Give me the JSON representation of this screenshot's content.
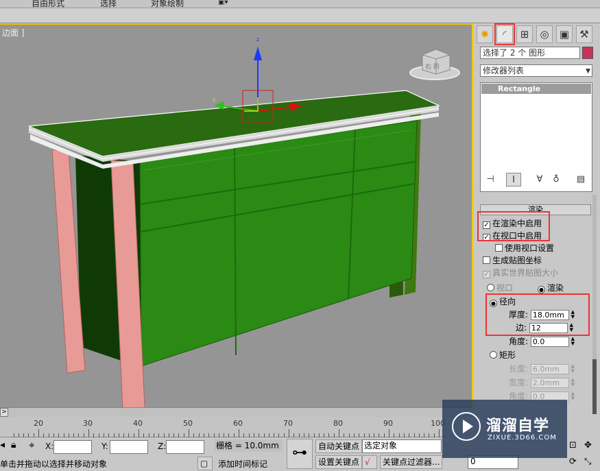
{
  "menu": {
    "items": [
      "自由形式",
      "选择",
      "对象绘制"
    ]
  },
  "viewport": {
    "label": "边面 ]",
    "viewcube_label": "右 前"
  },
  "command_panel": {
    "tabs": [
      "create-icon",
      "modify-icon",
      "hierarchy-icon",
      "motion-icon",
      "display-icon",
      "utilities-icon"
    ],
    "selection_text": "选择了 2 个 图形",
    "object_color": "#c8325a",
    "modifier_list": "修改器列表",
    "stack_item": "Rectangle"
  },
  "rendering": {
    "title": "渲染",
    "enable_in_renderer": "在渲染中启用",
    "enable_in_viewport": "在视口中启用",
    "use_viewport_settings": "使用视口设置",
    "gen_mapping_coords": "生成贴图坐标",
    "real_world_map_size": "真实世界贴图大小",
    "viewport_option": "视口",
    "render_option": "渲染",
    "radial": "径向",
    "thickness_label": "厚度:",
    "thickness_value": "18.0mm",
    "sides_label": "边:",
    "sides_value": "12",
    "angle_label": "角度:",
    "angle_value": "0.0",
    "rectangular": "矩形",
    "length_label": "长度:",
    "length_value": "6.0mm",
    "width_label": "宽度:",
    "width_value": "2.0mm",
    "angle2_label": "角度:",
    "angle2_value": "0.0"
  },
  "timeline": {
    "ticks": [
      "20",
      "30",
      "40",
      "50",
      "60",
      "70",
      "80",
      "90",
      "100"
    ]
  },
  "status": {
    "x_label": "X:",
    "y_label": "Y:",
    "z_label": "Z:",
    "grid": "栅格 = 10.0mm",
    "auto_key": "自动关键点",
    "set_key": "设置关键点",
    "selected_object": "选定对象",
    "key_filters": "关键点过滤器...",
    "prompt": "单击并拖动以选择并移动对象",
    "add_time_tag": "添加时间标记",
    "frame_value": "0"
  },
  "watermark": {
    "title": "溜溜自学",
    "subtitle": "ZIXUE.3D66.COM"
  }
}
